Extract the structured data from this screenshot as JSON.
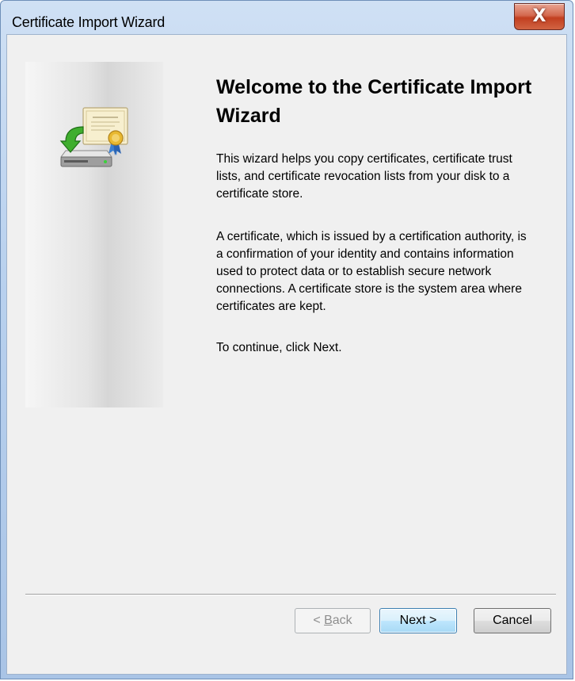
{
  "window": {
    "title": "Certificate Import Wizard",
    "close_label": "X"
  },
  "content": {
    "heading": "Welcome to the Certificate Import Wizard",
    "paragraph1": "This wizard helps you copy certificates, certificate trust lists, and certificate revocation lists from your disk to a certificate store.",
    "paragraph2": "A certificate, which is issued by a certification authority, is a confirmation of your identity and contains information used to protect data or to establish secure network connections. A certificate store is the system area where certificates are kept.",
    "paragraph3": "To continue, click Next."
  },
  "buttons": {
    "back_prefix": "< ",
    "back_accel": "B",
    "back_rest": "ack",
    "next_label": "Next >",
    "cancel_label": "Cancel"
  },
  "icons": {
    "wizard": "certificate-import-icon",
    "close": "close-icon"
  },
  "colors": {
    "title_bar": "#b9d1ee",
    "close_button": "#c23f20",
    "client_background": "#f0f0f0",
    "default_button_border": "#3c7fb1",
    "disabled_text": "#8e8e8e"
  }
}
